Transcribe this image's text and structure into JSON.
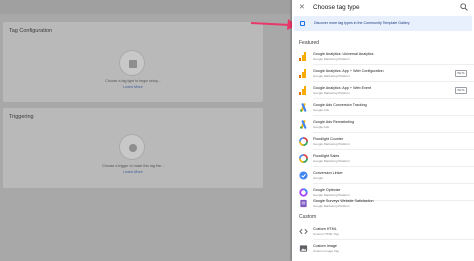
{
  "background": {
    "card1": {
      "title": "Tag Configuration",
      "line": "Choose a tag type to begin setup...",
      "link": "Learn More"
    },
    "card2": {
      "title": "Triggering",
      "line": "Choose a trigger to make this tag fire...",
      "link": "Learn More"
    }
  },
  "panel": {
    "title": "Choose tag type",
    "banner": "Discover more tag types in the Community Template Gallery",
    "featured_label": "Featured",
    "custom_label": "Custom",
    "featured": [
      {
        "name": "Google Analytics: Universal Analytics",
        "sub": "Google Marketing Platform",
        "icon": "analytics-icon",
        "beta": ""
      },
      {
        "name": "Google Analytics: App + Web Configuration",
        "sub": "Google Marketing Platform",
        "icon": "analytics-icon",
        "beta": "BETA"
      },
      {
        "name": "Google Analytics: App + Web Event",
        "sub": "Google Marketing Platform",
        "icon": "analytics-icon",
        "beta": "BETA"
      },
      {
        "name": "Google Ads Conversion Tracking",
        "sub": "Google Ads",
        "icon": "google-ads-icon",
        "beta": ""
      },
      {
        "name": "Google Ads Remarketing",
        "sub": "Google Ads",
        "icon": "google-ads-icon",
        "beta": ""
      },
      {
        "name": "Floodlight Counter",
        "sub": "Google Marketing Platform",
        "icon": "floodlight-icon",
        "beta": ""
      },
      {
        "name": "Floodlight Sales",
        "sub": "Google Marketing Platform",
        "icon": "floodlight-icon",
        "beta": ""
      },
      {
        "name": "Conversion Linker",
        "sub": "Google",
        "icon": "conversion-linker-icon",
        "beta": ""
      },
      {
        "name": "Google Optimize",
        "sub": "Google Marketing Platform",
        "icon": "optimize-icon",
        "beta": ""
      },
      {
        "name": "Google Surveys Website Satisfaction",
        "sub": "Google Marketing Platform",
        "icon": "surveys-icon",
        "beta": ""
      }
    ],
    "custom": [
      {
        "name": "Custom HTML",
        "sub": "Custom HTML Tag",
        "icon": "code-icon"
      },
      {
        "name": "Custom Image",
        "sub": "Custom Image Tag",
        "icon": "image-icon"
      }
    ]
  },
  "colors": {
    "accent": "#1a73e8",
    "analytics_orange": "#f9ab00",
    "banner_bg": "#e8f0fe",
    "arrow": "#e8386a"
  }
}
